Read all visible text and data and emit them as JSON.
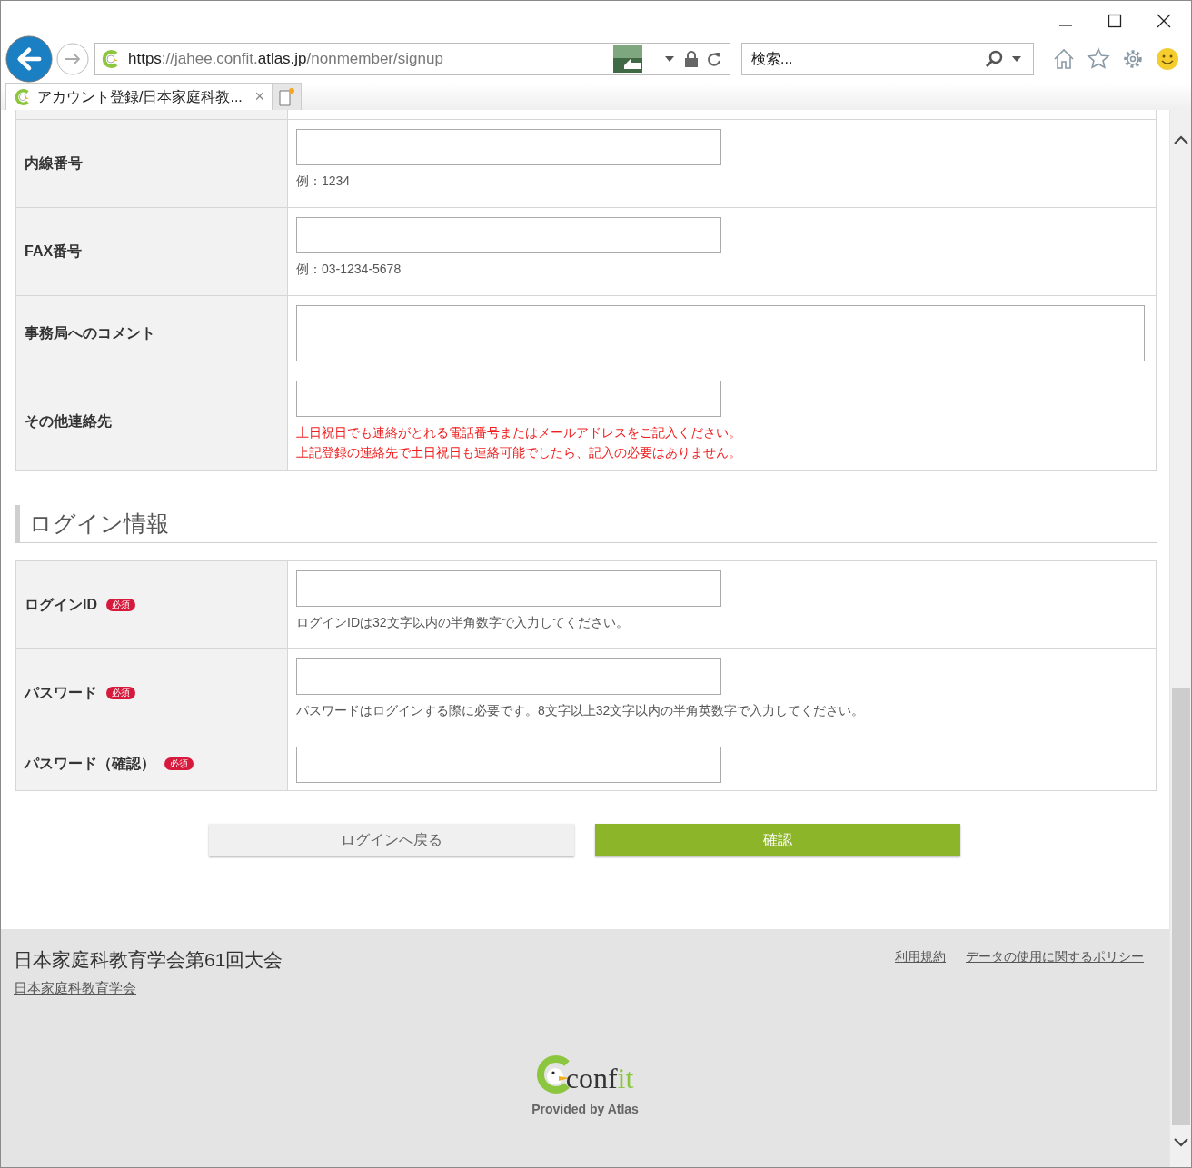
{
  "browser": {
    "url_host": "https://jahee.confit.",
    "url_domain": "atlas.jp",
    "url_path": "/nonmember/signup",
    "search_placeholder": "検索...",
    "tab_title": "アカウント登録/日本家庭科教...",
    "tab_close": "×"
  },
  "contact_rows": [
    {
      "label": "内線番号",
      "required": false,
      "kind": "input",
      "notes": [
        {
          "text": "例：1234",
          "kind": "hint"
        }
      ]
    },
    {
      "label": "FAX番号",
      "required": false,
      "kind": "input",
      "notes": [
        {
          "text": "例：03-1234-5678",
          "kind": "hint"
        }
      ]
    },
    {
      "label": "事務局へのコメント",
      "required": false,
      "kind": "textarea",
      "notes": []
    },
    {
      "label": "その他連絡先",
      "required": false,
      "kind": "input",
      "notes": [
        {
          "text": "土日祝日でも連絡がとれる電話番号またはメールアドレスをご記入ください。",
          "kind": "warning"
        },
        {
          "text": "上記登録の連絡先で土日祝日も連絡可能でしたら、記入の必要はありません。",
          "kind": "warning"
        }
      ]
    }
  ],
  "login_section": {
    "heading": "ログイン情報"
  },
  "login_rows": [
    {
      "label": "ログインID",
      "required": true,
      "required_badge": "必須",
      "kind": "input",
      "notes": [
        {
          "text": "ログインIDは32文字以内の半角数字で入力してください。",
          "kind": "hint"
        }
      ]
    },
    {
      "label": "パスワード",
      "required": true,
      "required_badge": "必須",
      "kind": "input",
      "notes": [
        {
          "text": "パスワードはログインする際に必要です。8文字以上32文字以内の半角英数字で入力してください。",
          "kind": "hint"
        }
      ]
    },
    {
      "label": "パスワード（確認）",
      "required": true,
      "required_badge": "必須",
      "kind": "input",
      "notes": []
    }
  ],
  "buttons": [
    {
      "label": "ログインへ戻る",
      "kind": "secondary"
    },
    {
      "label": "確認",
      "kind": "primary"
    }
  ],
  "footer": {
    "title": "日本家庭科教育学会第61回大会",
    "org_link": "日本家庭科教育学会",
    "links": [
      "利用規約",
      "データの使用に関するポリシー"
    ],
    "logo_text": "conf",
    "logo_accent": "it",
    "provided_by": "Provided by Atlas"
  }
}
